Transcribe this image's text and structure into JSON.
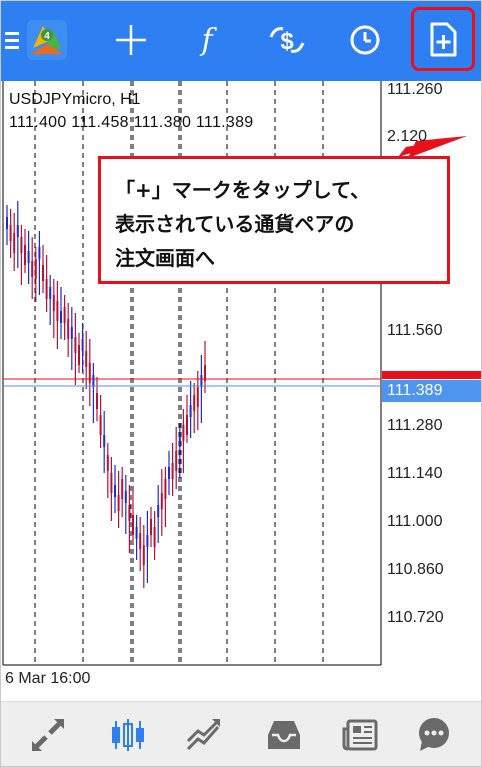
{
  "toolbar": {
    "icons": [
      "menu-icon",
      "mt4-logo",
      "crosshair-icon",
      "indicators-icon",
      "objects-icon",
      "period-icon",
      "new-order-icon"
    ],
    "accent": "#2e7ff2",
    "highlight": "#e8101a"
  },
  "chart": {
    "symbol": "USDJPYmicro, H1",
    "ohlc": "111.400 111.458 111.380 111.389",
    "price_ticks": [
      "111.260",
      "2.120",
      "111.560",
      "111.280",
      "111.140",
      "111.000",
      "110.860",
      "110.720"
    ],
    "current_price": "111.389",
    "time_label": "6 Mar 16:00",
    "bull_color": "#1a2dc9",
    "bear_color": "#b3133b"
  },
  "callout": {
    "text": "「+」マークをタップして、\n表示されている通貨ペアの\n注文画面へ"
  },
  "bottom_nav": {
    "icons": [
      "quotes-icon",
      "chart-icon",
      "trade-icon",
      "history-icon",
      "news-icon",
      "chat-icon"
    ],
    "active": "chart-icon"
  }
}
